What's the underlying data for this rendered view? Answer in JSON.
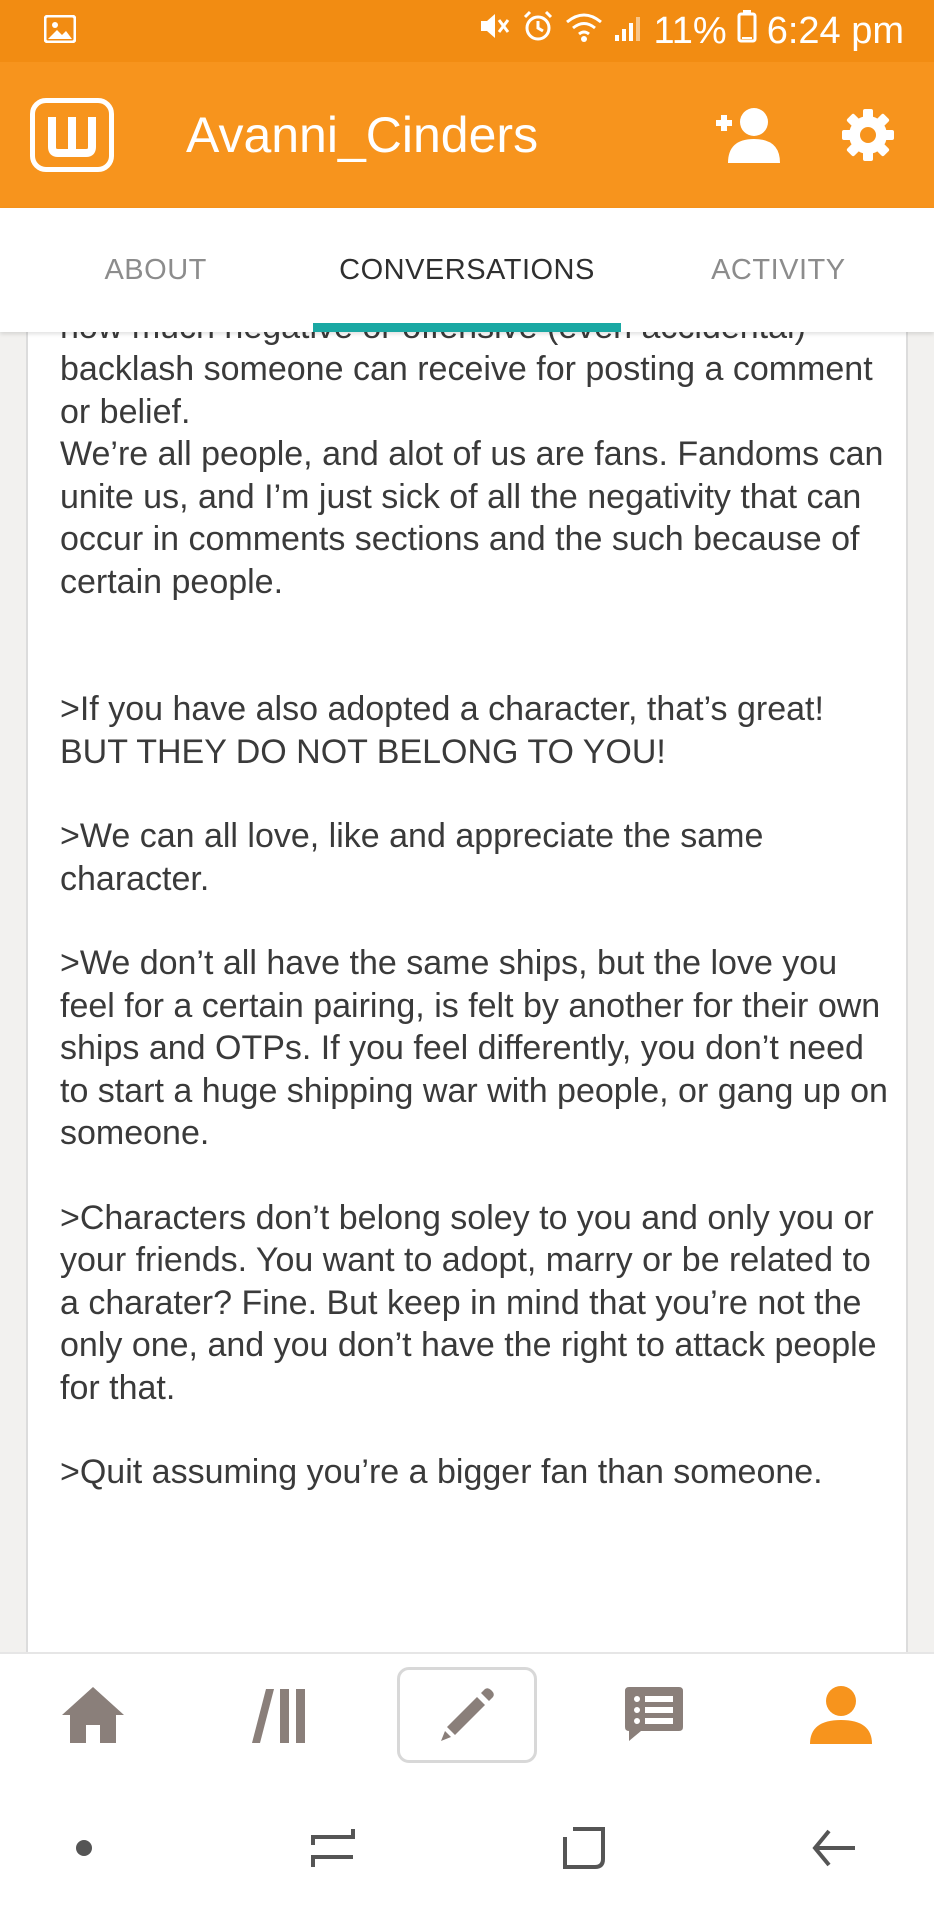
{
  "status_bar": {
    "battery": "11%",
    "time": "6:24 pm"
  },
  "header": {
    "title": "Avanni_Cinders",
    "icons": [
      "wattpad-logo-icon",
      "add-friend-icon",
      "settings-gear-icon"
    ]
  },
  "tabs": [
    {
      "label": "ABOUT"
    },
    {
      "label": "CONVERSATIONS"
    },
    {
      "label": "ACTIVITY"
    }
  ],
  "active_tab": "CONVERSATIONS",
  "colors": {
    "status_bar": "#f28c12",
    "app_bar": "#f7941d",
    "tab_indicator": "#1aa8a3",
    "profile_active": "#f7941d",
    "nav_icon": "#8a7f7a"
  },
  "message": {
    "cut_line": "how much negative or offensive (even accidental)",
    "paragraph_1": "backlash someone can receive for posting a comment or belief.",
    "paragraph_2": "We’re all people, and alot of us are fans. Fandoms can unite us, and I’m just sick of all the negativity that can occur in comments sections and the such because of certain people.",
    "paragraph_3": ">If you have also adopted a character, that’s great! BUT THEY DO NOT BELONG TO YOU!",
    "paragraph_4": ">We can all love, like and appreciate the same character.",
    "paragraph_5": ">We don’t all have the same ships, but the love you feel for a certain pairing, is felt by another for their own ships and OTPs. If you feel differently, you don’t need to start a huge shipping war with people, or gang up on someone.",
    "paragraph_6": ">Characters don’t belong soley to you and only you or your friends. You want to adopt, marry or be related to a charater? Fine. But keep in mind that you’re not the only one, and you don’t have the right to attack people for that.",
    "paragraph_7": ">Quit assuming you’re a bigger fan than someone."
  },
  "bottom_nav": [
    "home-icon",
    "library-icon",
    "write-pencil-icon",
    "messages-icon",
    "profile-icon"
  ],
  "system_nav": [
    "dot-icon",
    "recent-apps-icon",
    "home-square-icon",
    "back-arrow-icon"
  ]
}
